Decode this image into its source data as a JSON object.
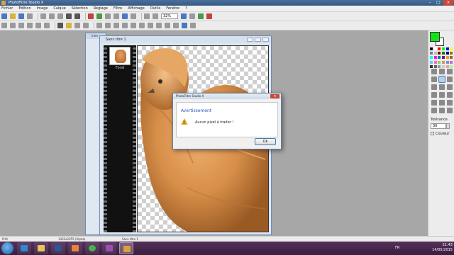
{
  "app": {
    "title": "PhotoFiltre Studio X",
    "window_controls": [
      "–",
      "□",
      "×"
    ]
  },
  "menu": [
    "Fichier",
    "Edition",
    "Image",
    "Calque",
    "Sélection",
    "Réglage",
    "Filtre",
    "Affichage",
    "Outils",
    "Fenêtre",
    "?"
  ],
  "toolbar": {
    "zoom_value": "32%"
  },
  "documents": {
    "back_title": "Inter",
    "front_title": "Sans titre 1",
    "layer_name": "Fond"
  },
  "dialog": {
    "title": "PhotoFiltre Studio X",
    "close": "×",
    "heading": "Avertissement",
    "icon": "warning-icon",
    "message": "Aucun pixel à traiter !",
    "ok": "Ok"
  },
  "tools_panel": {
    "fg_color": "#13e41a",
    "bg_color": "#ffffff",
    "tolerance_label": "Tolérance",
    "tolerance_value": "30",
    "couleur_label": "Couleur"
  },
  "status": {
    "state": "Prêt",
    "dimensions": "1432x2055 (Alpha)",
    "doc_name": "Sans titre 1"
  },
  "taskbar": {
    "apps": [
      "ie-icon",
      "explorer-icon",
      "word-icon",
      "media-icon",
      "chrome-icon",
      "app-icon",
      "photofiltre-icon"
    ],
    "lang": "FR",
    "time": "21:43",
    "date": "14/05/2015"
  }
}
